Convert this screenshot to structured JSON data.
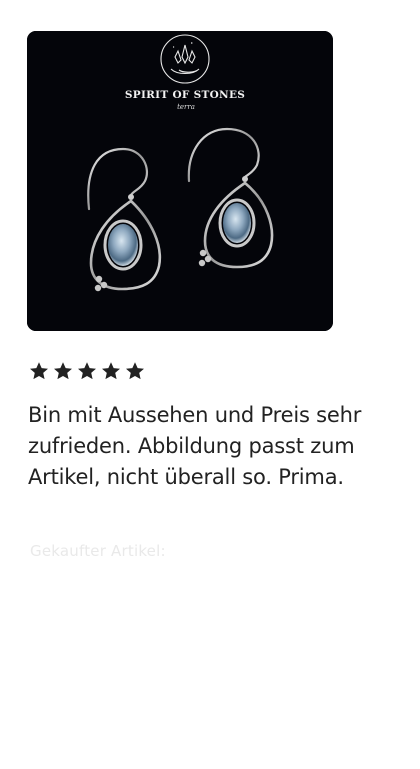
{
  "image": {
    "brand_name": "SPIRIT OF STONES",
    "brand_sub": "terra"
  },
  "review": {
    "rating": 5,
    "max_rating": 5,
    "text": "Bin mit Aussehen und Preis sehr zufrieden. Abbildung passt zum Artikel, nicht überall so. Prima.",
    "purchase_link_label": "Gekaufter Artikel:"
  },
  "colors": {
    "text": "#222222",
    "image_background": "#04050a",
    "faded_link": "#e9e9e9"
  }
}
